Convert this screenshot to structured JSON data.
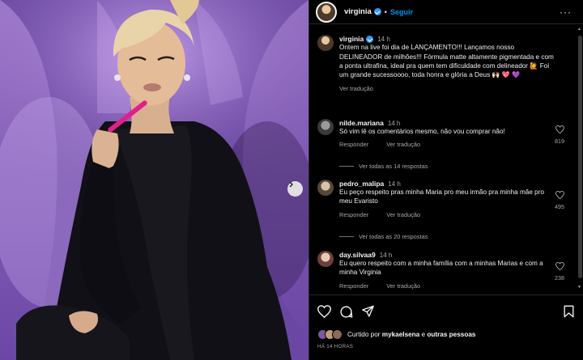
{
  "header": {
    "username": "virginia",
    "separator": "•",
    "follow_label": "Seguir",
    "more_label": "···"
  },
  "caption": {
    "username": "virginia",
    "time": "14 h",
    "text": "Ontem na live foi dia de LANÇAMENTO!!! Lançamos nosso DELINEADOR de milhões!!! Fórmula matte altamente pigmentada e com a ponta ultrafina, ideal pra quem tem dificuldade com delineador 🙋 Foi um grande sucessoooo, toda honra e glória a Deus 🙌🏻 💖 💜",
    "see_translation": "Ver tradução"
  },
  "comments": [
    {
      "username": "nilde.mariana",
      "time": "14 h",
      "text": "Só vim lê os comentários mesmo, não vou comprar não!",
      "reply": "Responder",
      "translate": "Ver tradução",
      "likes": "819",
      "replies_label": "Ver todas as 14 respostas"
    },
    {
      "username": "pedro_malipa",
      "time": "14 h",
      "text": "Eu peço respeito pras minha Maria pro meu irmão pra minha mãe pro meu Evaristo",
      "reply": "Responder",
      "translate": "Ver tradução",
      "likes": "495",
      "replies_label": "Ver todas as 20 respostas"
    },
    {
      "username": "day.silvaa9",
      "time": "14 h",
      "text": "Eu quero respeito com a minha família com a minhas Marias e com a minha Virginia",
      "reply": "Responder",
      "translate": "Ver tradução",
      "likes": "238"
    }
  ],
  "footer": {
    "liked_prefix": "Curtido por",
    "liked_user": "mykaelsena",
    "liked_middle": "e",
    "liked_others": "outras pessoas",
    "time_ago": "HÁ 14 HORAS"
  },
  "colors": {
    "accent": "#0095f6",
    "verified": "#3897f0",
    "background": "#000000",
    "lipliner": "#e0208a"
  },
  "icons": {
    "like": "heart-icon",
    "comment": "comment-icon",
    "share": "send-icon",
    "save": "bookmark-icon",
    "next": "chevron-right-icon"
  }
}
